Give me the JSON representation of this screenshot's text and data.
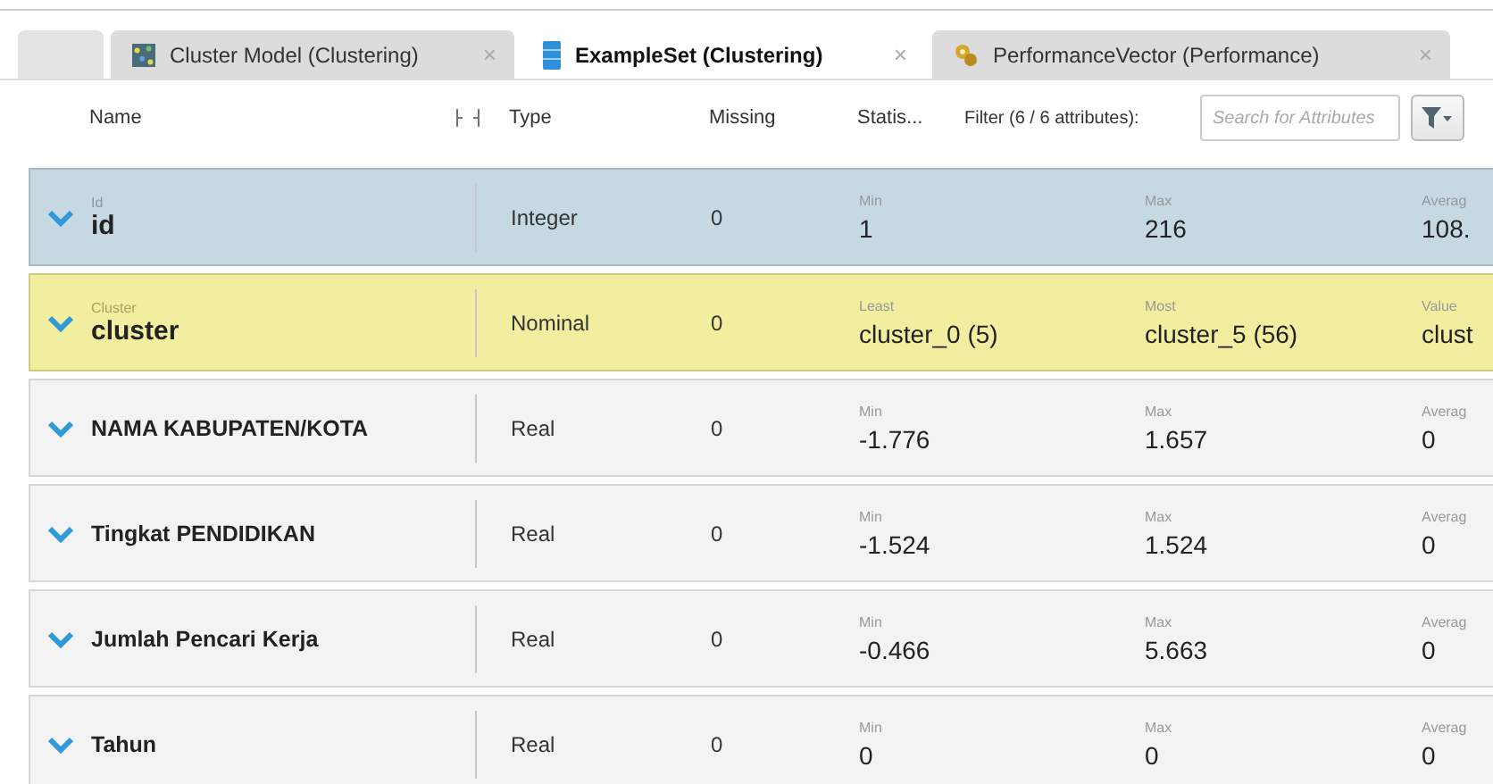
{
  "tabs": [
    {
      "label": "Cluster Model (Clustering)",
      "kind": "model",
      "close": "×",
      "selected": false
    },
    {
      "label": "ExampleSet (Clustering)",
      "kind": "data",
      "close": "×",
      "selected": true
    },
    {
      "label": "PerformanceVector (Performance)",
      "kind": "performance",
      "close": "×",
      "selected": false
    }
  ],
  "header": {
    "name": "Name",
    "type": "Type",
    "missing": "Missing",
    "statistics": "Statis...",
    "filter_label": "Filter (6 / 6 attributes):",
    "search": {
      "placeholder": "Search for Attributes"
    }
  },
  "rows": [
    {
      "kind": "id",
      "role_label": "Id",
      "name": "id",
      "type": "Integer",
      "missing": "0",
      "stats": [
        {
          "label": "Min",
          "value": "1"
        },
        {
          "label": "Max",
          "value": "216"
        },
        {
          "label": "Averag",
          "value": "108."
        }
      ]
    },
    {
      "kind": "cluster",
      "role_label": "Cluster",
      "name": "cluster",
      "type": "Nominal",
      "missing": "0",
      "stats": [
        {
          "label": "Least",
          "value": "cluster_0 (5)"
        },
        {
          "label": "Most",
          "value": "cluster_5 (56)"
        },
        {
          "label": "Value",
          "value": "clust"
        }
      ]
    },
    {
      "kind": "regular",
      "name": "NAMA KABUPATEN/KOTA",
      "type": "Real",
      "missing": "0",
      "stats": [
        {
          "label": "Min",
          "value": "-1.776"
        },
        {
          "label": "Max",
          "value": "1.657"
        },
        {
          "label": "Averag",
          "value": "0"
        }
      ]
    },
    {
      "kind": "regular",
      "name": "Tingkat PENDIDIKAN",
      "type": "Real",
      "missing": "0",
      "stats": [
        {
          "label": "Min",
          "value": "-1.524"
        },
        {
          "label": "Max",
          "value": "1.524"
        },
        {
          "label": "Averag",
          "value": "0"
        }
      ]
    },
    {
      "kind": "regular",
      "name": "Jumlah Pencari Kerja",
      "type": "Real",
      "missing": "0",
      "stats": [
        {
          "label": "Min",
          "value": "-0.466"
        },
        {
          "label": "Max",
          "value": "5.663"
        },
        {
          "label": "Averag",
          "value": "0"
        }
      ]
    },
    {
      "kind": "regular",
      "name": "Tahun",
      "type": "Real",
      "missing": "0",
      "stats": [
        {
          "label": "Min",
          "value": "0"
        },
        {
          "label": "Max",
          "value": "0"
        },
        {
          "label": "Averag",
          "value": "0"
        }
      ]
    }
  ]
}
